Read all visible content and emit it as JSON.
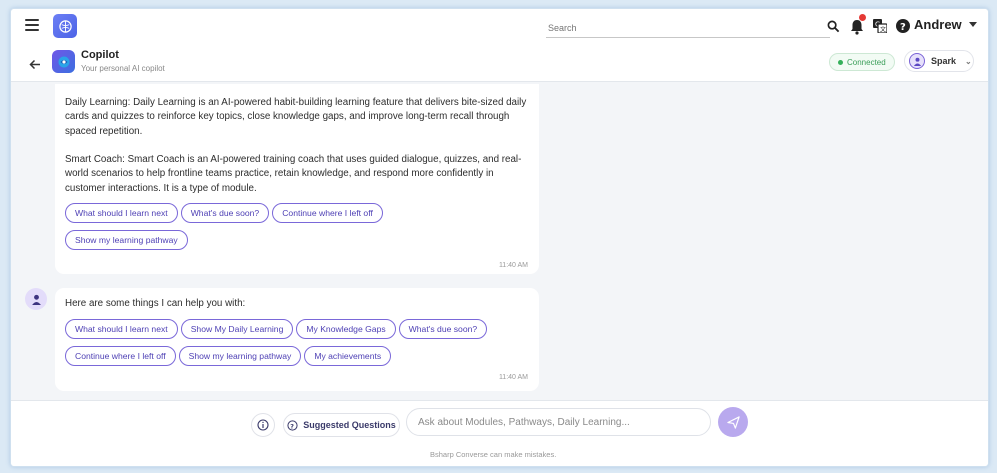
{
  "topbar": {
    "search_placeholder": "Search",
    "user_name": "Andrew"
  },
  "header": {
    "title": "Copilot",
    "subtitle": "Your personal AI copilot",
    "status": "Connected",
    "agent_name": "Spark"
  },
  "messages": [
    {
      "paragraphs": [
        "Daily Learning: Daily Learning is an AI-powered habit-building learning feature that delivers bite-sized daily cards and quizzes to reinforce key topics, close knowledge gaps, and improve long-term recall through spaced repetition.",
        "Smart Coach: Smart Coach is an AI-powered training coach that uses guided dialogue, quizzes, and real-world scenarios to help frontline teams practice, retain knowledge, and respond more confidently in customer interactions. It is a type of module."
      ],
      "chips": [
        "What should I learn next",
        "What's due soon?",
        "Continue where I left off",
        "Show my learning pathway"
      ],
      "time": "11:40 AM"
    },
    {
      "text": "Here are some things I can help you with:",
      "chips": [
        "What should I learn next",
        "Show My Daily Learning",
        "My Knowledge Gaps",
        "What's due soon?",
        "Continue where I left off",
        "Show my learning pathway",
        "My achievements"
      ],
      "time": "11:40 AM"
    }
  ],
  "composer": {
    "suggested_label": "Suggested Questions",
    "input_placeholder": "Ask about Modules, Pathways, Daily Learning...",
    "disclaimer": "Bsharp Converse can make mistakes."
  },
  "colors": {
    "accent": "#7a68d9",
    "accent_text": "#4d3fb4",
    "send_button": "#b9a9ee",
    "connected": "#35b05a",
    "notification": "#e53935"
  },
  "icons": [
    "menu-icon",
    "brain-logo-icon",
    "search-icon",
    "bell-icon",
    "translate-icon",
    "help-icon",
    "back-arrow-icon",
    "copilot-logo-icon",
    "user-avatar-icon",
    "bot-avatar-icon",
    "info-icon",
    "question-circle-icon",
    "send-icon"
  ]
}
